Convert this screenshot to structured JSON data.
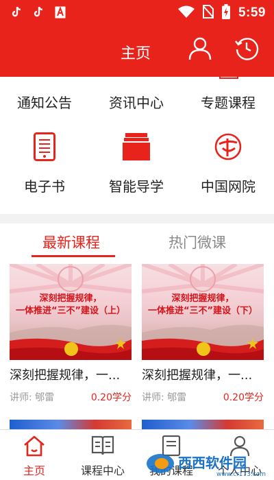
{
  "status_bar": {
    "time": "5:59",
    "icons": [
      "tiktok-icon",
      "tiktok-icon",
      "app-a-icon",
      "wifi-icon",
      "no-sim-icon",
      "battery-charging-icon"
    ]
  },
  "header": {
    "title": "主页",
    "icons": [
      "user-icon",
      "history-clock-icon"
    ]
  },
  "categories": [
    {
      "label": "通知公告",
      "icon": "notice-icon"
    },
    {
      "label": "资讯中心",
      "icon": "news-icon"
    },
    {
      "label": "专题课程",
      "icon": "topic-course-icon"
    },
    {
      "label": "电子书",
      "icon": "ebook-icon"
    },
    {
      "label": "智能导学",
      "icon": "smart-guide-icon"
    },
    {
      "label": "中国网院",
      "icon": "china-web-academy-icon"
    }
  ],
  "tabs": [
    {
      "label": "最新课程",
      "active": true
    },
    {
      "label": "热门微课",
      "active": false
    }
  ],
  "courses": [
    {
      "thumb_line1": "深刻把握规律，",
      "thumb_line2": "一体推进“三不”建设（上）",
      "title": "深刻把握规律，一...",
      "teacher": "讲师:  郇雷",
      "credits": "0.20学分"
    },
    {
      "thumb_line1": "深刻把握规律，",
      "thumb_line2": "一体推进“三不”建设（下）",
      "title": "深刻把握规律，一...",
      "teacher": "讲师:  郇雷",
      "credits": "0.20学分"
    }
  ],
  "bottom_nav": [
    {
      "label": "主页",
      "icon": "home-icon",
      "active": true
    },
    {
      "label": "课程中心",
      "icon": "book-icon",
      "active": false
    },
    {
      "label": "我的课程",
      "icon": "my-course-icon",
      "active": false
    },
    {
      "label": "个人中心",
      "icon": "person-icon",
      "active": false
    }
  ],
  "watermark": {
    "text": "西西软件园",
    "url_text": "www.cr173.com"
  },
  "colors": {
    "brand_red": "#e8231b",
    "separator_gray": "#f2f2f2",
    "muted_text": "#999999"
  }
}
